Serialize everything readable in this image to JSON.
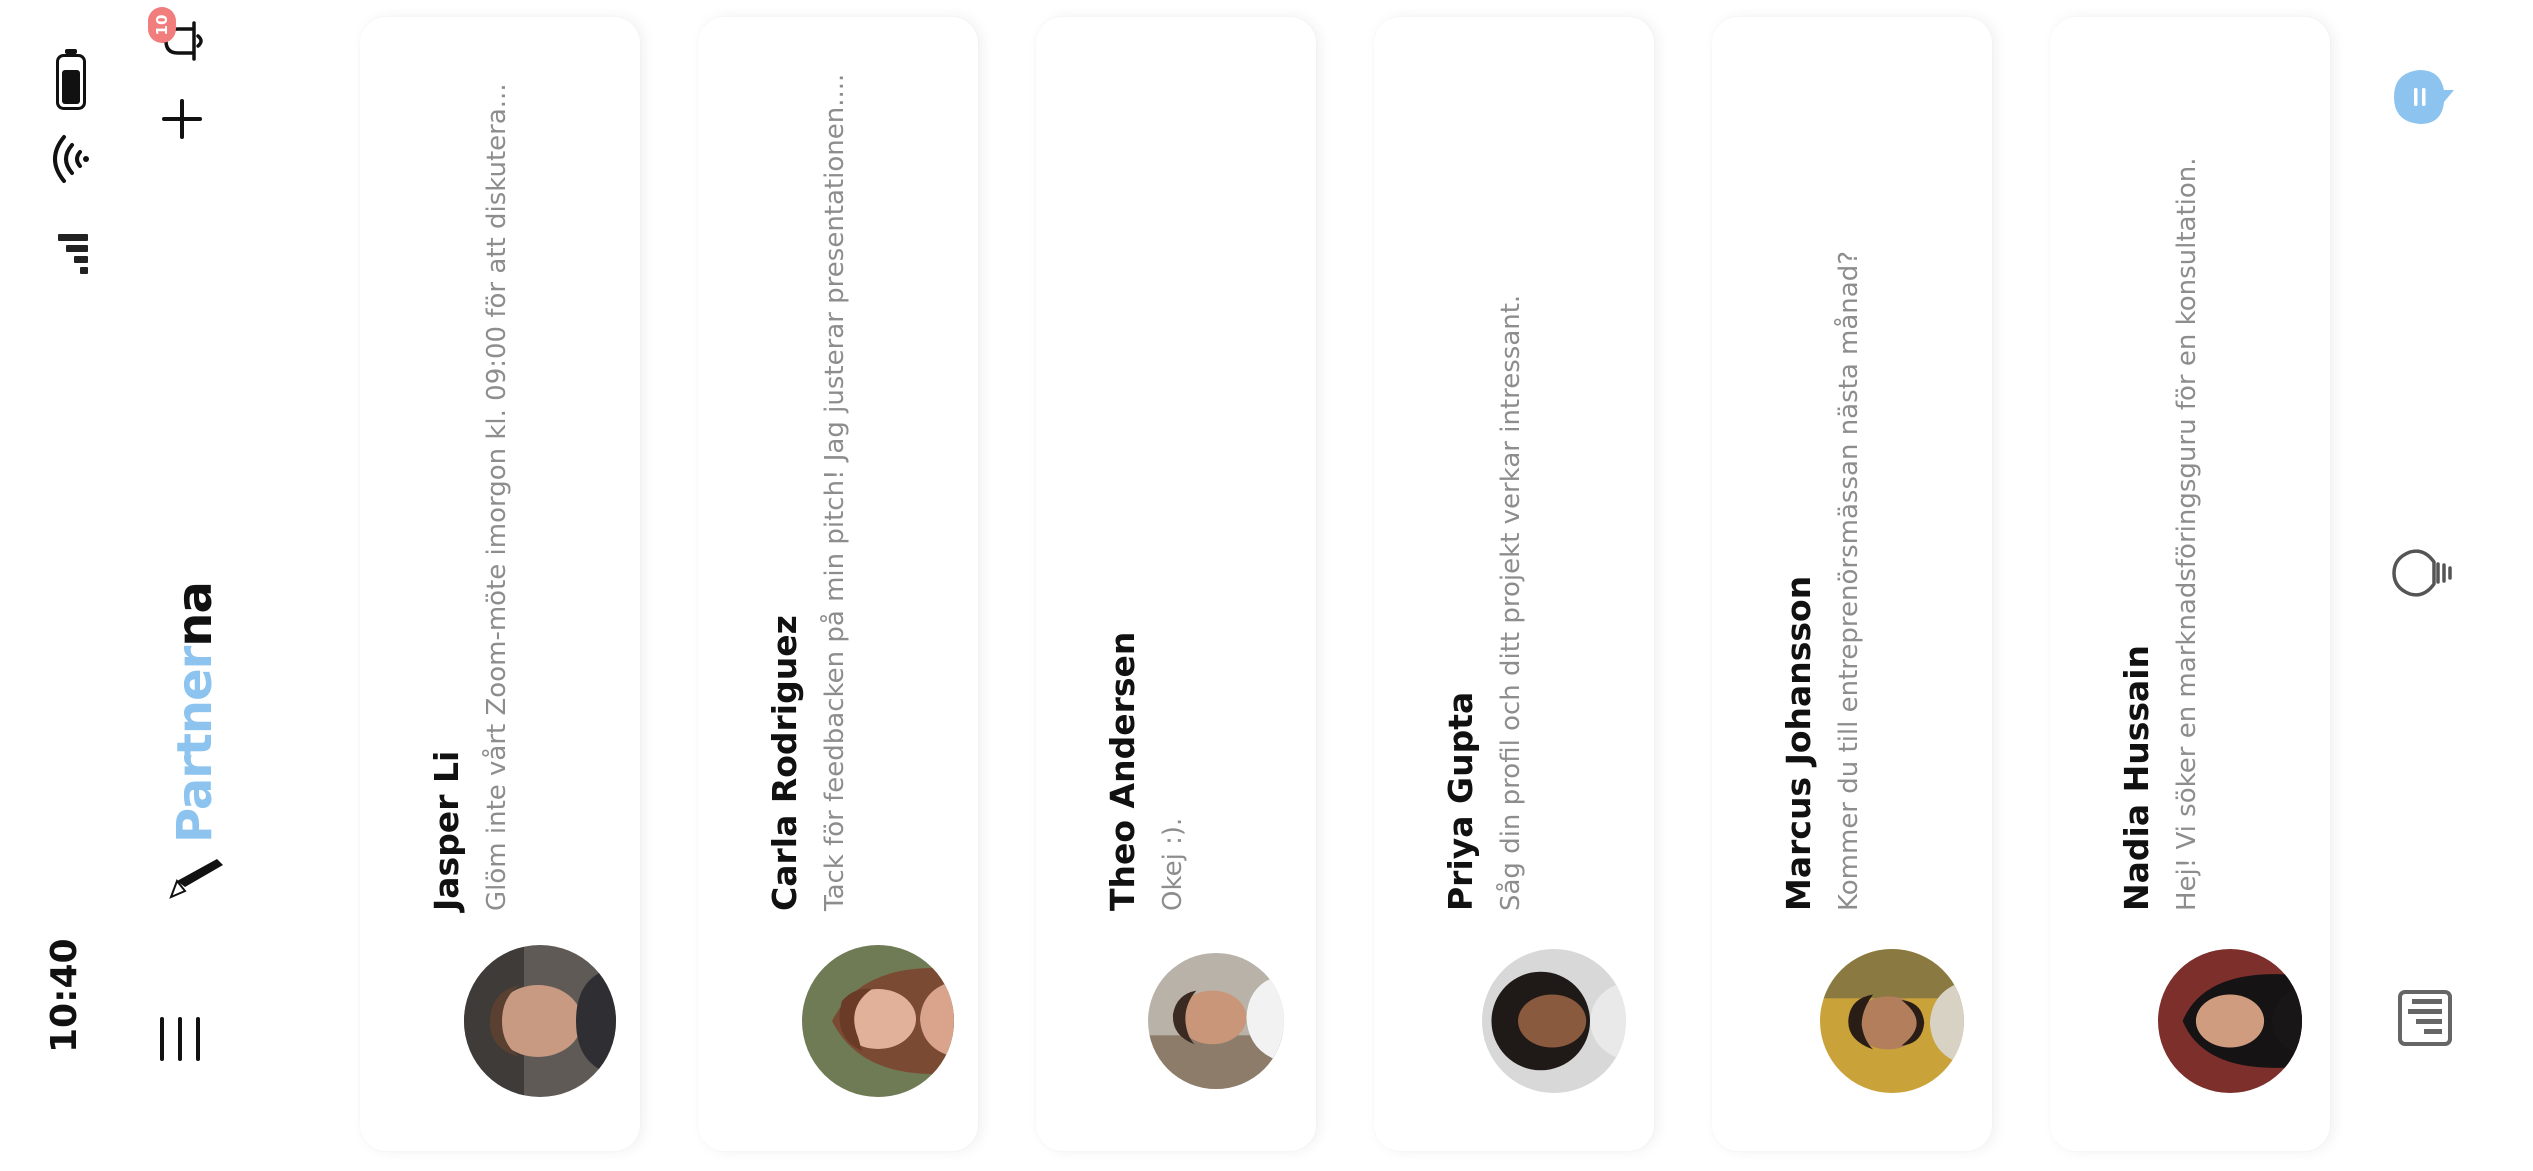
{
  "status_bar": {
    "time": "10:40"
  },
  "header": {
    "logo_part_light": "Partner",
    "logo_part_dark": "na",
    "notification_count": "10"
  },
  "conversations": [
    {
      "name": "Jasper Li",
      "preview": "Glöm inte vårt Zoom-möte imorgon kl. 09:00 för att diskutera..."
    },
    {
      "name": "Carla Rodriguez",
      "preview": "Tack för feedbacken på min pitch! Jag justerar presentationen...."
    },
    {
      "name": "Theo Andersen",
      "preview": "Okej :)."
    },
    {
      "name": "Priya Gupta",
      "preview": "Såg din profil och ditt projekt verkar intressant."
    },
    {
      "name": "Marcus Johansson",
      "preview": "Kommer du till entreprenörsmässan nästa månad?"
    },
    {
      "name": "Nadia Hussain",
      "preview": "Hej! Vi söker en marknadsföringsguru för en konsultation."
    }
  ],
  "colors": {
    "accent": "#8cc4ef",
    "badge": "#f27d7d",
    "text_primary": "#111111",
    "text_secondary": "#8d8d8d"
  },
  "icons": {
    "menu": "menu-icon",
    "logo": "tie-logo-icon",
    "add": "plus-icon",
    "notifications": "bell-icon",
    "nav_dashboard": "bar-chart-icon",
    "nav_ideas": "lightbulb-icon",
    "nav_messages": "chat-bubble-icon"
  }
}
